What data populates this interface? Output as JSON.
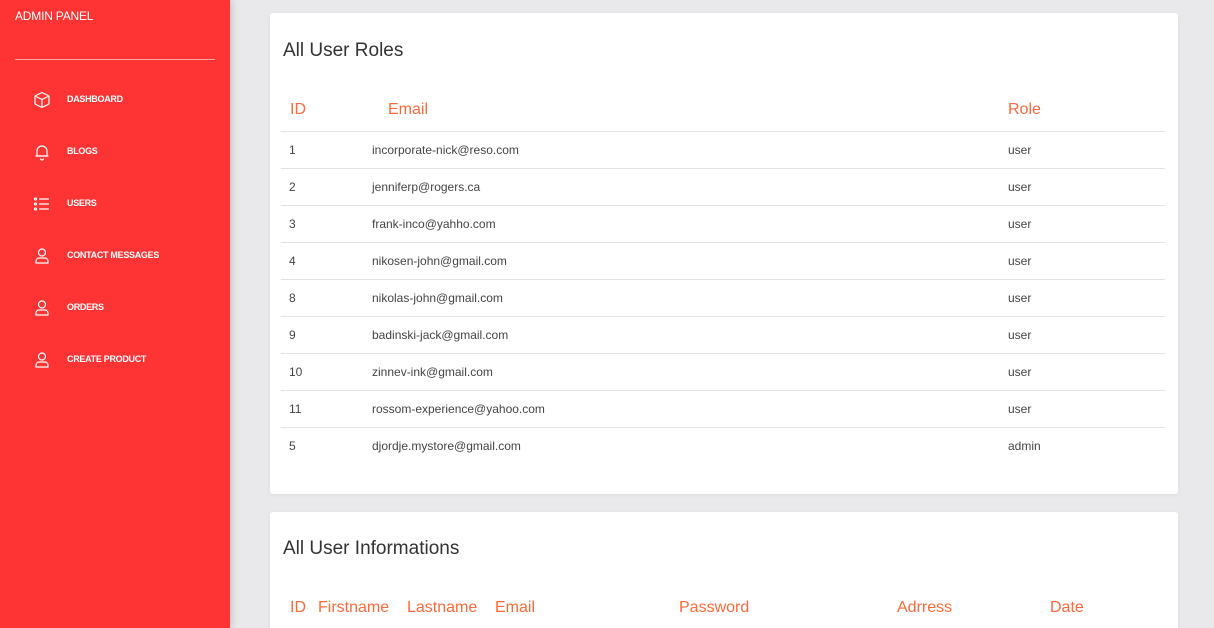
{
  "sidebar": {
    "brand": "ADMIN PANEL",
    "items": [
      {
        "label": "DASHBOARD",
        "icon": "cube-icon"
      },
      {
        "label": "BLOGS",
        "icon": "bell-icon"
      },
      {
        "label": "USERS",
        "icon": "list-icon"
      },
      {
        "label": "CONTACT MESSAGES",
        "icon": "user-icon"
      },
      {
        "label": "ORDERS",
        "icon": "user-icon"
      },
      {
        "label": "CREATE PRODUCT",
        "icon": "user-icon"
      }
    ]
  },
  "roles": {
    "title": "All User Roles",
    "headers": {
      "id": "ID",
      "email": "Email",
      "role": "Role"
    },
    "rows": [
      {
        "id": "1",
        "email": "incorporate-nick@reso.com",
        "role": "user"
      },
      {
        "id": "2",
        "email": "jenniferp@rogers.ca",
        "role": "user"
      },
      {
        "id": "3",
        "email": "frank-inco@yahho.com",
        "role": "user"
      },
      {
        "id": "4",
        "email": "nikosen-john@gmail.com",
        "role": "user"
      },
      {
        "id": "8",
        "email": "nikolas-john@gmail.com",
        "role": "user"
      },
      {
        "id": "9",
        "email": "badinski-jack@gmail.com",
        "role": "user"
      },
      {
        "id": "10",
        "email": "zinnev-ink@gmail.com",
        "role": "user"
      },
      {
        "id": "11",
        "email": "rossom-experience@yahoo.com",
        "role": "user"
      },
      {
        "id": "5",
        "email": "djordje.mystore@gmail.com",
        "role": "admin"
      }
    ]
  },
  "info": {
    "title": "All User Informations",
    "headers": {
      "id": "ID",
      "firstname": "Firstname",
      "lastname": "Lastname",
      "email": "Email",
      "password": "Password",
      "address": "Adrress",
      "date": "Date"
    }
  },
  "colors": {
    "sidebar": "#fe3333",
    "header_text": "#fb6a3a",
    "background": "#e9e9ec"
  }
}
